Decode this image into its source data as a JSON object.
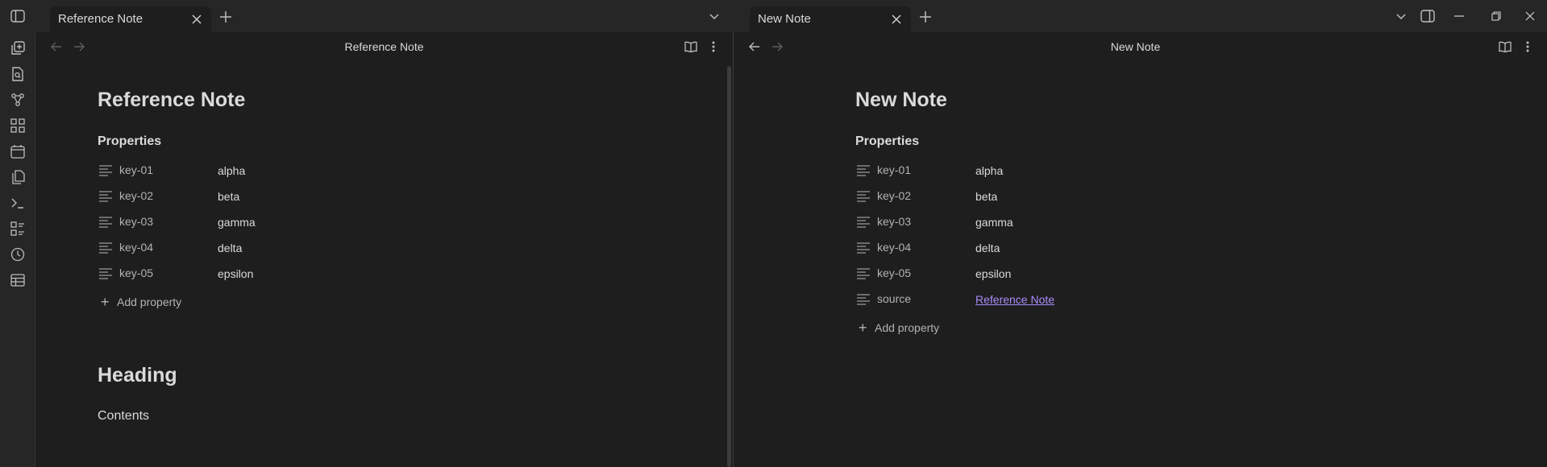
{
  "tabs": {
    "left": {
      "label": "Reference Note"
    },
    "right": {
      "label": "New Note"
    }
  },
  "ribbon_icons": [
    "new-note-icon",
    "open-file-icon",
    "graph-view-icon",
    "canvas-icon",
    "calendar-icon",
    "files-icon",
    "terminal-icon",
    "templates-icon",
    "history-icon",
    "table-icon"
  ],
  "left_pane": {
    "header_title": "Reference Note",
    "note_title": "Reference Note",
    "properties_heading": "Properties",
    "properties": [
      {
        "key": "key-01",
        "value": "alpha"
      },
      {
        "key": "key-02",
        "value": "beta"
      },
      {
        "key": "key-03",
        "value": "gamma"
      },
      {
        "key": "key-04",
        "value": "delta"
      },
      {
        "key": "key-05",
        "value": "epsilon"
      }
    ],
    "add_property": "Add property",
    "heading": "Heading",
    "contents": "Contents"
  },
  "right_pane": {
    "header_title": "New Note",
    "note_title": "New Note",
    "properties_heading": "Properties",
    "properties": [
      {
        "key": "key-01",
        "value": "alpha"
      },
      {
        "key": "key-02",
        "value": "beta"
      },
      {
        "key": "key-03",
        "value": "gamma"
      },
      {
        "key": "key-04",
        "value": "delta"
      },
      {
        "key": "key-05",
        "value": "epsilon"
      },
      {
        "key": "source",
        "value": "Reference Note"
      }
    ],
    "add_property": "Add property"
  },
  "colors": {
    "background": "#1e1e1e",
    "chrome": "#262626",
    "link": "#a88bfa"
  }
}
